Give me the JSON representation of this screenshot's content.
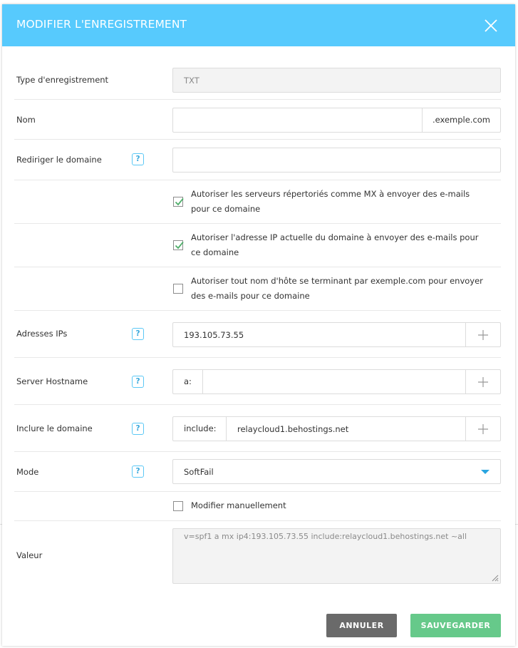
{
  "dialog": {
    "title": "MODIFIER L'ENREGISTREMENT"
  },
  "form": {
    "type": {
      "label": "Type d'enregistrement",
      "value": "TXT"
    },
    "nom": {
      "label": "Nom",
      "value": "",
      "suffix": ".exemple.com"
    },
    "redirect": {
      "label": "Rediriger le domaine",
      "help": "?",
      "value": ""
    },
    "options": [
      {
        "label": "Autoriser les serveurs répertoriés comme MX à envoyer des e-mails pour ce domaine",
        "checked": true
      },
      {
        "label": "Autoriser l'adresse IP actuelle du domaine à envoyer des e-mails pour ce domaine",
        "checked": true
      },
      {
        "label": "Autoriser tout nom d'hôte se terminant par exemple.com pour envoyer des e-mails pour ce domaine",
        "checked": false
      }
    ],
    "ips": {
      "label": "Adresses IPs",
      "help": "?",
      "value": "193.105.73.55"
    },
    "hostname": {
      "label": "Server Hostname",
      "help": "?",
      "prefix": "a:",
      "value": ""
    },
    "include": {
      "label": "Inclure le domaine",
      "help": "?",
      "prefix": "include:",
      "value": "relaycloud1.behostings.net"
    },
    "mode": {
      "label": "Mode",
      "help": "?",
      "value": "SoftFail"
    },
    "manual": {
      "label": "Modifier manuellement",
      "checked": false
    },
    "valeur": {
      "label": "Valeur",
      "value": "v=spf1 a mx ip4:193.105.73.55 include:relaycloud1.behostings.net ~all"
    }
  },
  "buttons": {
    "cancel": "ANNULER",
    "save": "SAUVEGARDER"
  },
  "colors": {
    "header": "#57cafd",
    "check": "#4fae6a",
    "help": "#5bc8f5",
    "cancel": "#6a6a6a",
    "save": "#66c98a"
  }
}
